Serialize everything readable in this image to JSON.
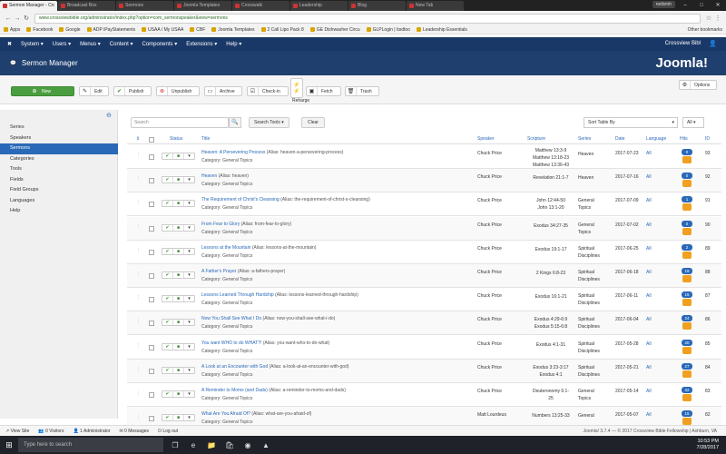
{
  "browser": {
    "tabs": [
      {
        "label": "Sermon Manager - Cro",
        "active": true
      },
      {
        "label": "Broadcast Box",
        "active": false
      },
      {
        "label": "Sermons",
        "active": false
      },
      {
        "label": "Joomla Templates",
        "active": false
      },
      {
        "label": "Crosswalk",
        "active": false
      },
      {
        "label": "Leadership",
        "active": false
      },
      {
        "label": "Blog",
        "active": false
      },
      {
        "label": "New Tab",
        "active": false
      }
    ],
    "profile": "neilsmh",
    "url": "www.crossviewbible.org/administrator/index.php?option=com_sermonspeaker&view=sermons",
    "bookmarks": [
      "Apps",
      "Facebook",
      "Google",
      "ADP iPayStatements",
      "USAA / My USAA",
      "CBF",
      "Joomla Templates",
      "2 Call Lipo Pack 8",
      "GE Dishwasher Circu",
      "GLPLogin | bsdtoo",
      "Leadership Essentials"
    ],
    "other_bookmarks": "Other bookmarks"
  },
  "adminbar": {
    "menus": [
      "System",
      "Users",
      "Menus",
      "Content",
      "Components",
      "Extensions",
      "Help"
    ],
    "site_name": "Crossview Bibl"
  },
  "header": {
    "title": "Sermon Manager",
    "logo": "Joomla!"
  },
  "toolbar": {
    "new": "New",
    "edit": "Edit",
    "publish": "Publish",
    "unpublish": "Unpublish",
    "archive": "Archive",
    "checkin": "Check-in",
    "rehit": "Re-Hit",
    "rehit_sub": "Reharge",
    "fetch": "Fetch",
    "trash": "Trash",
    "options": "Options"
  },
  "sidebar": {
    "items": [
      "Series",
      "Speakers",
      "Sermons",
      "Categories",
      "Tools",
      "Fields",
      "Field Groups",
      "Languages",
      "Help"
    ],
    "active": 2
  },
  "filters": {
    "search_placeholder": "Search",
    "search_tools": "Search Tools",
    "clear": "Clear",
    "sort": "Sort Table By",
    "limit": "All"
  },
  "table": {
    "headers": {
      "status": "Status",
      "title": "Title",
      "speaker": "Speaker",
      "scripture": "Scripture",
      "series": "Series",
      "date": "Date",
      "language": "Language",
      "hits": "Hits",
      "id": "ID"
    },
    "rows": [
      {
        "title": "Heaven: A Persevering Process",
        "alias": "(Alias: heaven-a-persevering-process)",
        "category": "Category: General Topics",
        "speaker": "Chuck Price",
        "scripture": [
          "Matthew 13:3-9",
          "Matthew 13:18-23",
          "Matthew 13:36-43"
        ],
        "series": [
          "Heaven"
        ],
        "date": "2017-07-23",
        "language": "All",
        "hits": "0",
        "id": "93"
      },
      {
        "title": "Heaven",
        "alias": "(Alias: heaven)",
        "category": "Category: General Topics",
        "speaker": "Chuck Price",
        "scripture": [
          "Revelation 21:1-7"
        ],
        "series": [
          "Heaven"
        ],
        "date": "2017-07-16",
        "language": "All",
        "hits": "0",
        "id": "92"
      },
      {
        "title": "The Requirement of Christ's Cleansing",
        "alias": "(Alias: the-requirement-of-christ-s-cleansing)",
        "category": "Category: General Topics",
        "speaker": "Chuck Price",
        "scripture": [
          "John 12:44-50",
          "John 13:1-20"
        ],
        "series": [
          "General",
          "Topics"
        ],
        "date": "2017-07-09",
        "language": "All",
        "hits": "1",
        "id": "91"
      },
      {
        "title": "From Fear to Glory",
        "alias": "(Alias: from-fear-to-glory)",
        "category": "Category: General Topics",
        "speaker": "Chuck Price",
        "scripture": [
          "Exodus 34:27-35"
        ],
        "series": [
          "General",
          "Topics"
        ],
        "date": "2017-07-02",
        "language": "All",
        "hits": "0",
        "id": "90"
      },
      {
        "title": "Lessons at the Mountain",
        "alias": "(Alias: lessons-at-the-mountain)",
        "category": "Category: General Topics",
        "speaker": "Chuck Price",
        "scripture": [
          "Exodus 19:1-17"
        ],
        "series": [
          "Spiritual",
          "Disciplines"
        ],
        "date": "2017-06-25",
        "language": "All",
        "hits": "2",
        "id": "89"
      },
      {
        "title": "A Father's Prayer",
        "alias": "(Alias: a-fathers-prayer)",
        "category": "Category: General Topics",
        "speaker": "Chuck Price",
        "scripture": [
          "2 Kings 6:8-23"
        ],
        "series": [
          "Spiritual",
          "Disciplines"
        ],
        "date": "2017-06-18",
        "language": "All",
        "hits": "19",
        "id": "88"
      },
      {
        "title": "Lessons Learned Through Hardship",
        "alias": "(Alias: lessons-learned-through-hardship)",
        "category": "Category: General Topics",
        "speaker": "Chuck Price",
        "scripture": [
          "Exodus 16:1-21"
        ],
        "series": [
          "Spiritual",
          "Disciplines"
        ],
        "date": "2017-06-11",
        "language": "All",
        "hits": "15",
        "id": "87"
      },
      {
        "title": "Now You Shall See What I Do",
        "alias": "(Alias: now-you-shall-see-what-i-do)",
        "category": "Category: General Topics",
        "speaker": "Chuck Price",
        "scripture": [
          "Exodus 4:29-6:9",
          "Exodus 5:15-6:8"
        ],
        "series": [
          "Spiritual",
          "Disciplines"
        ],
        "date": "2017-06-04",
        "language": "All",
        "hits": "24",
        "id": "86"
      },
      {
        "title": "You want WHO to do WHAT?!",
        "alias": "(Alias: you-want-who-to-do-what)",
        "category": "Category: General Topics",
        "speaker": "Chuck Price",
        "scripture": [
          "Exodus 4:1-31"
        ],
        "series": [
          "Spiritual",
          "Disciplines"
        ],
        "date": "2017-05-28",
        "language": "All",
        "hits": "20",
        "id": "85"
      },
      {
        "title": "A Look at an Encounter with God",
        "alias": "(Alias: a-look-at-an-encounter-with-god)",
        "category": "Category: General Topics",
        "speaker": "Chuck Price",
        "scripture": [
          "Exodus 3:23-3:17",
          "Exodus 4:1"
        ],
        "series": [
          "Spiritual",
          "Disciplines"
        ],
        "date": "2017-05-21",
        "language": "All",
        "hits": "27",
        "id": "84"
      },
      {
        "title": "A Reminder to Moms (and Dads)",
        "alias": "(Alias: a-reminder-to-moms-and-dads)",
        "category": "Category: General Topics",
        "speaker": "Chuck Price",
        "scripture": [
          "Deuteronomy 6:1-",
          "25"
        ],
        "series": [
          "General",
          "Topics"
        ],
        "date": "2017-05-14",
        "language": "All",
        "hits": "32",
        "id": "83"
      },
      {
        "title": "What Are You Afraid Of?",
        "alias": "(Alias: what-are-you-afraid-of)",
        "category": "Category: General Topics",
        "speaker": "Matt Lourdeus",
        "scripture": [
          "Numbers 13:25-33"
        ],
        "series": [
          "General"
        ],
        "date": "2017-05-07",
        "language": "All",
        "hits": "15",
        "id": "82"
      }
    ]
  },
  "statusbar": {
    "items": [
      "View Site",
      "0 Visitors",
      "1 Administrator",
      "0 Messages",
      "Log out"
    ],
    "copyright": "Joomla! 3.7.4 — © 2017 Crossview Bible Fellowship | Ashburn, VA"
  },
  "taskbar": {
    "search": "Type here to search",
    "time": "10:53 PM",
    "date": "7/28/2017"
  }
}
